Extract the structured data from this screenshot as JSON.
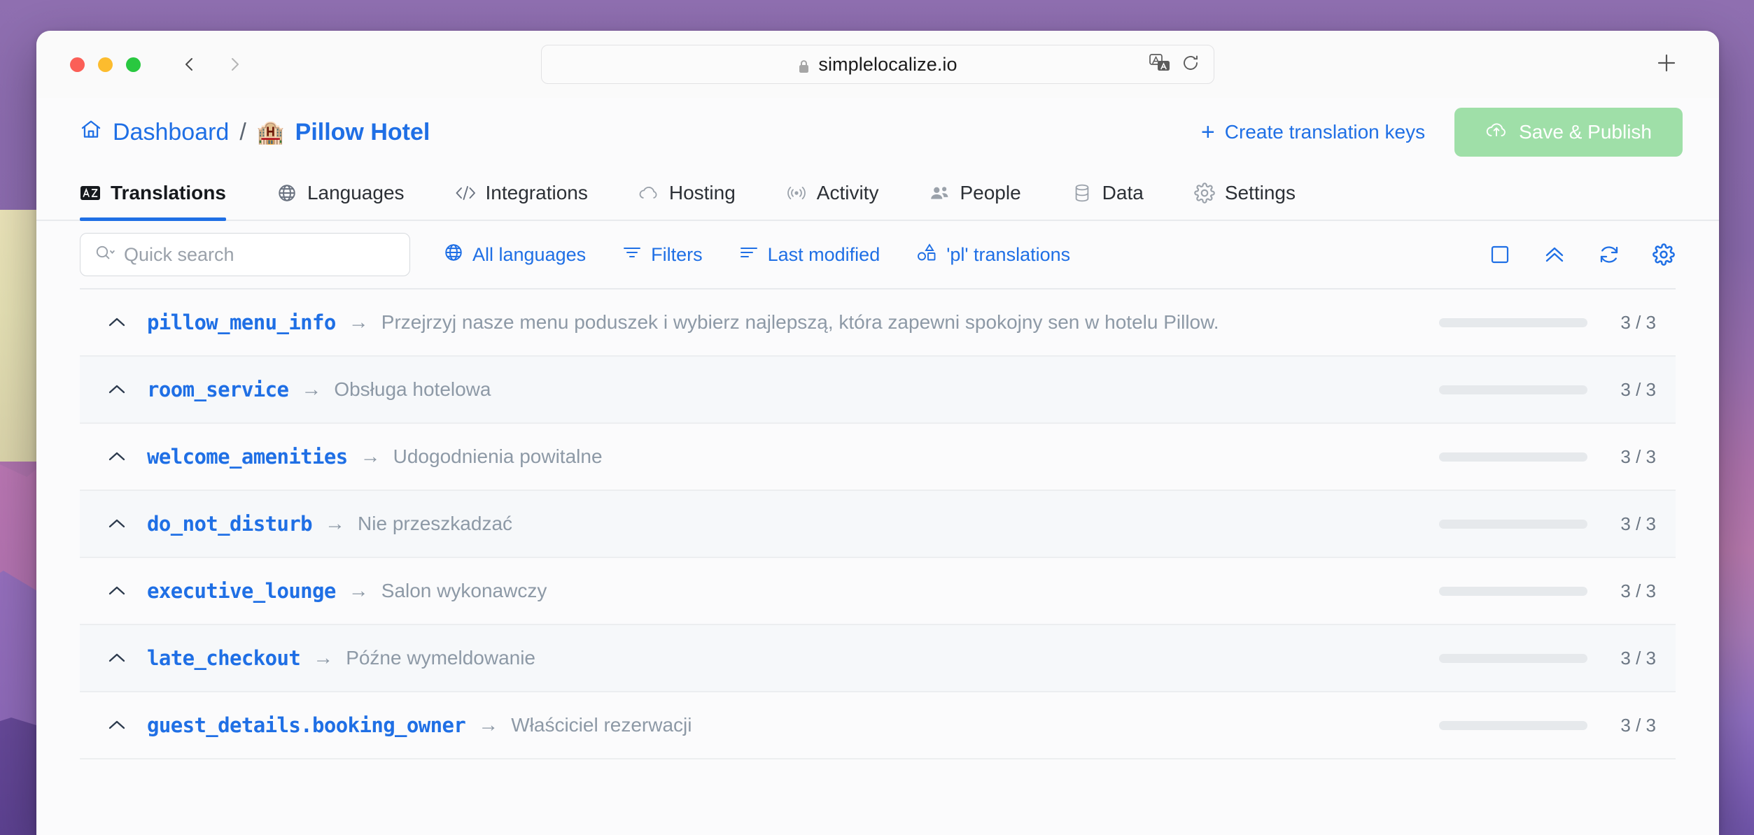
{
  "browser": {
    "traffic_lights": [
      "close",
      "minimize",
      "maximize"
    ],
    "back_label": "Back",
    "forward_label": "Forward",
    "url": "simplelocalize.io",
    "lock_icon": "lock-icon",
    "translate_icon": "translate-icon",
    "reload_icon": "reload-icon",
    "new_tab_icon": "plus-icon"
  },
  "header": {
    "home_icon": "home-icon",
    "dashboard_label": "Dashboard",
    "separator": "/",
    "project_emoji": "🏨",
    "project_name": "Pillow Hotel",
    "create_keys_label": "Create translation keys",
    "create_keys_icon": "plus-icon",
    "save_publish_label": "Save & Publish",
    "save_publish_icon": "cloud-upload-icon",
    "save_publish_color": "#9fdfa8",
    "accent_color": "#1f6fe5"
  },
  "tabs": [
    {
      "label": "Translations",
      "icon": "translate-box-icon",
      "active": true
    },
    {
      "label": "Languages",
      "icon": "globe-icon",
      "active": false
    },
    {
      "label": "Integrations",
      "icon": "code-icon",
      "active": false
    },
    {
      "label": "Hosting",
      "icon": "cloud-icon",
      "active": false
    },
    {
      "label": "Activity",
      "icon": "broadcast-icon",
      "active": false
    },
    {
      "label": "People",
      "icon": "users-icon",
      "active": false
    },
    {
      "label": "Data",
      "icon": "database-icon",
      "active": false
    },
    {
      "label": "Settings",
      "icon": "gear-icon",
      "active": false
    }
  ],
  "toolbar": {
    "search_placeholder": "Quick search",
    "search_value": "",
    "search_icon": "search-icon",
    "links": [
      {
        "label": "All languages",
        "icon": "globe-icon"
      },
      {
        "label": "Filters",
        "icon": "filter-icon"
      },
      {
        "label": "Last modified",
        "icon": "sort-icon"
      },
      {
        "label": "'pl' translations",
        "icon": "shapes-icon"
      }
    ],
    "right_icons": [
      {
        "name": "select-all-icon"
      },
      {
        "name": "collapse-all-icon"
      },
      {
        "name": "refresh-icon"
      },
      {
        "name": "gear-icon"
      }
    ]
  },
  "table": {
    "progress_color": "#16b14b",
    "rows": [
      {
        "key": "pillow_menu_info",
        "arrow": "→",
        "value": "Przejrzyj nasze menu poduszek i wybierz najlepszą, która zapewni spokojny sen w hotelu Pillow.",
        "count": "3 / 3",
        "done": 3,
        "total": 3
      },
      {
        "key": "room_service",
        "arrow": "→",
        "value": "Obsługa hotelowa",
        "count": "3 / 3",
        "done": 3,
        "total": 3
      },
      {
        "key": "welcome_amenities",
        "arrow": "→",
        "value": "Udogodnienia powitalne",
        "count": "3 / 3",
        "done": 3,
        "total": 3
      },
      {
        "key": "do_not_disturb",
        "arrow": "→",
        "value": "Nie przeszkadzać",
        "count": "3 / 3",
        "done": 3,
        "total": 3
      },
      {
        "key": "executive_lounge",
        "arrow": "→",
        "value": "Salon wykonawczy",
        "count": "3 / 3",
        "done": 3,
        "total": 3
      },
      {
        "key": "late_checkout",
        "arrow": "→",
        "value": "Późne wymeldowanie",
        "count": "3 / 3",
        "done": 3,
        "total": 3
      },
      {
        "key": "guest_details.booking_owner",
        "arrow": "→",
        "value": "Właściciel rezerwacji",
        "count": "3 / 3",
        "done": 3,
        "total": 3
      }
    ]
  }
}
